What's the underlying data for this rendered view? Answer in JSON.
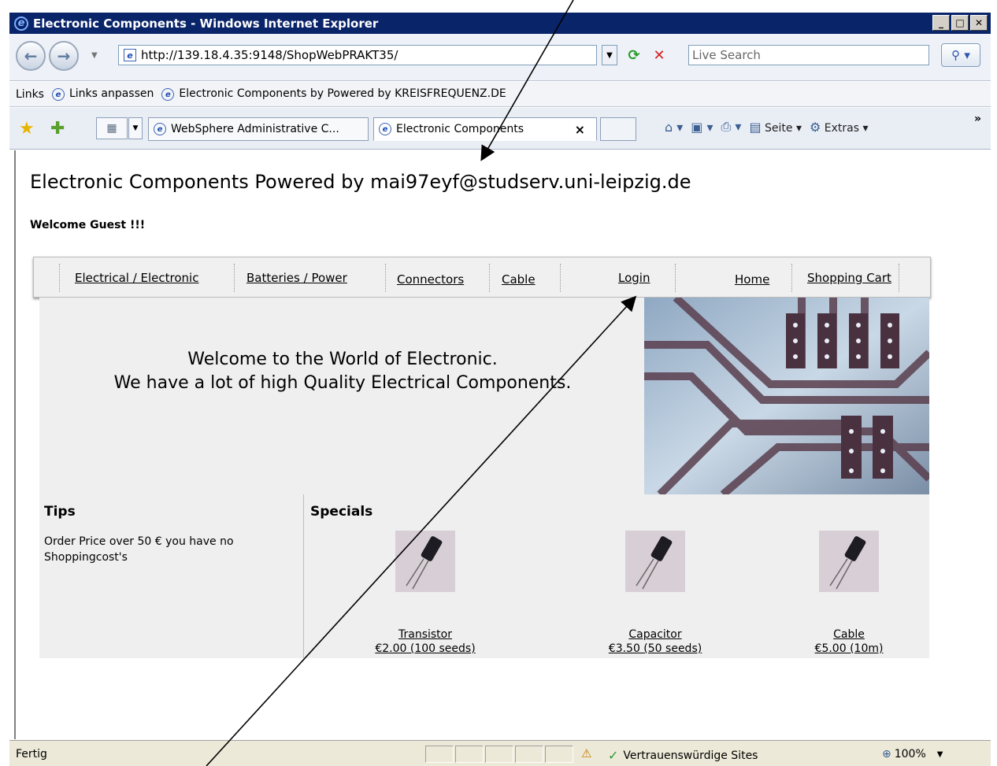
{
  "window": {
    "title": "Electronic Components - Windows Internet Explorer",
    "minimize": "_",
    "maximize": "□",
    "close": "✕"
  },
  "address_bar": {
    "url": "http://139.18.4.35:9148/ShopWebPRAKT35/",
    "search_placeholder": "Live Search"
  },
  "links_bar": {
    "label": "Links",
    "items": [
      "Links anpassen",
      "Electronic Components by Powered by KREISFREQUENZ.DE"
    ]
  },
  "tabs": [
    {
      "label": "WebSphere Administrative C..."
    },
    {
      "label": "Electronic Components",
      "close": "×"
    }
  ],
  "command_bar": {
    "page": "Seite",
    "tools": "Extras"
  },
  "page": {
    "title": "Electronic Components Powered by mai97eyf@studserv.uni-leipzig.de",
    "welcome": "Welcome Guest !!!",
    "menu": [
      "Electrical / Electronic",
      "Batteries / Power",
      "Connectors",
      "Cable",
      "Login",
      "Home",
      "Shopping Cart"
    ],
    "banner_line1": "Welcome to the World of Electronic.",
    "banner_line2": "We have a lot of high Quality Electrical Components.",
    "tips_title": "Tips",
    "tips_text": "Order Price over 50 € you have no Shoppingcost's",
    "specials_title": "Specials",
    "products": [
      {
        "name": "Transistor",
        "price": "€2.00 (100 seeds)"
      },
      {
        "name": "Capacitor",
        "price": "€3.50 (50 seeds)"
      },
      {
        "name": "Cable",
        "price": "€5.00 (10m)"
      }
    ]
  },
  "status_bar": {
    "status": "Fertig",
    "zone": "Vertrauenswürdige Sites",
    "zoom": "100%"
  }
}
